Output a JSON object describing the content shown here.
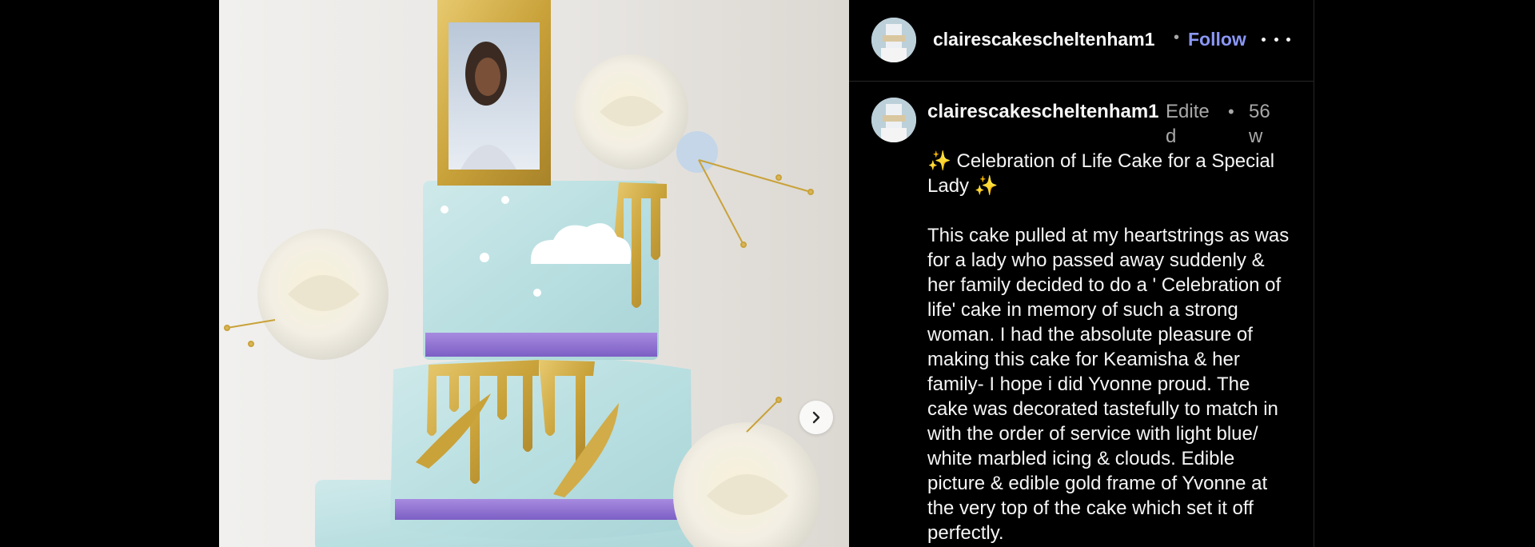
{
  "post": {
    "username": "clairescakescheltenham1",
    "follow_label": "Follow",
    "separator": "•",
    "more_icon": "more-horizontal-icon",
    "next_icon": "chevron-right-icon"
  },
  "caption": {
    "username": "clairescakescheltenham1",
    "edited_label": "Edited",
    "separator": "•",
    "age": "56w",
    "text": "✨ Celebration of Life Cake for a Special Lady ✨\n\nThis cake pulled at my heartstrings as was for a lady who passed away suddenly & her family decided to do a ' Celebration of life' cake in memory of such a strong woman. I had the absolute pleasure of making this cake for Keamisha & her family- I hope i did Yvonne proud. The cake was decorated tastefully to match in with the order of service with light blue/ white marbled icing & clouds. Edible picture & edible gold frame of Yvonne at the very top of the cake which set it off perfectly."
  },
  "colors": {
    "background": "#000000",
    "text": "#f5f5f5",
    "muted": "#a8a8a8",
    "follow": "#8a97f5",
    "divider": "#262626"
  }
}
